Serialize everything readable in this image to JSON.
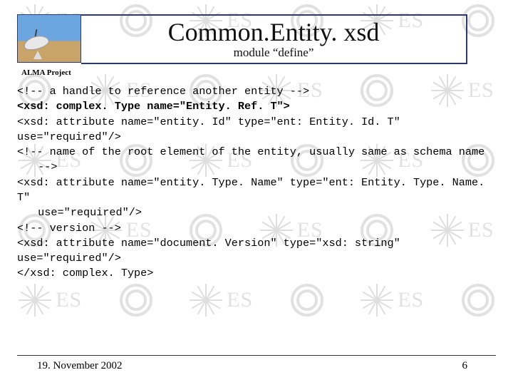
{
  "header": {
    "title": "Common.Entity. xsd",
    "subtitle": "module “define”",
    "project_label": "ALMA Project"
  },
  "code": {
    "l1": "<!-- a handle to reference another entity -->",
    "l2": "<xsd: complex. Type name=\"Entity. Ref. T\">",
    "l3": "<xsd: attribute name=\"entity. Id\" type=\"ent: Entity. Id. T\" use=\"required\"/>",
    "l4a": "<!-- name of the root element of the entity, usually same as schema name",
    "l4b": "-->",
    "l5a": "<xsd: attribute name=\"entity. Type. Name\" type=\"ent: Entity. Type. Name. T\"",
    "l5b": "use=\"required\"/>",
    "l6": "<!-- version -->",
    "l7": "<xsd: attribute name=\"document. Version\" type=\"xsd: string\" use=\"required\"/>",
    "l8": "</xsd: complex. Type>"
  },
  "footer": {
    "date": "19. November 2002",
    "page": "6"
  }
}
